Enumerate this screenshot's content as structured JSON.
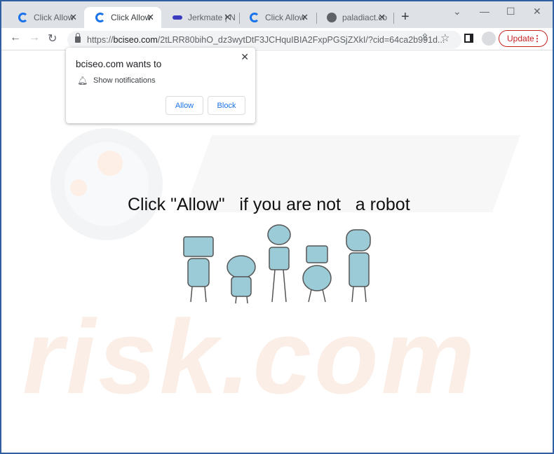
{
  "tabs": [
    {
      "label": "Click Allow",
      "icon": "refresh-favicon",
      "active": false
    },
    {
      "label": "Click Allow",
      "icon": "refresh-favicon",
      "active": true
    },
    {
      "label": "Jerkmate | N",
      "icon": "jerkmate-favicon",
      "active": false
    },
    {
      "label": "Click Allow",
      "icon": "refresh-favicon",
      "active": false
    },
    {
      "label": "paladiact.co",
      "icon": "globe-icon",
      "active": false
    }
  ],
  "address": {
    "scheme": "https://",
    "host": "bciseo.com",
    "path": "/2tLRR80bihO_dz3wytDtF3JCHquIBIA2FxpPGSjZXkI/?cid=64ca2b991d..."
  },
  "update_label": "Update",
  "popup": {
    "title": "bciseo.com wants to",
    "permission": "Show notifications",
    "allow": "Allow",
    "block": "Block"
  },
  "page": {
    "message": "Click \"Allow\"   if you are not   a robot"
  },
  "watermark": "PC risk.com",
  "colors": {
    "accent": "#1a73e8",
    "update": "#c5221f",
    "robot": "#9ccbd8"
  }
}
